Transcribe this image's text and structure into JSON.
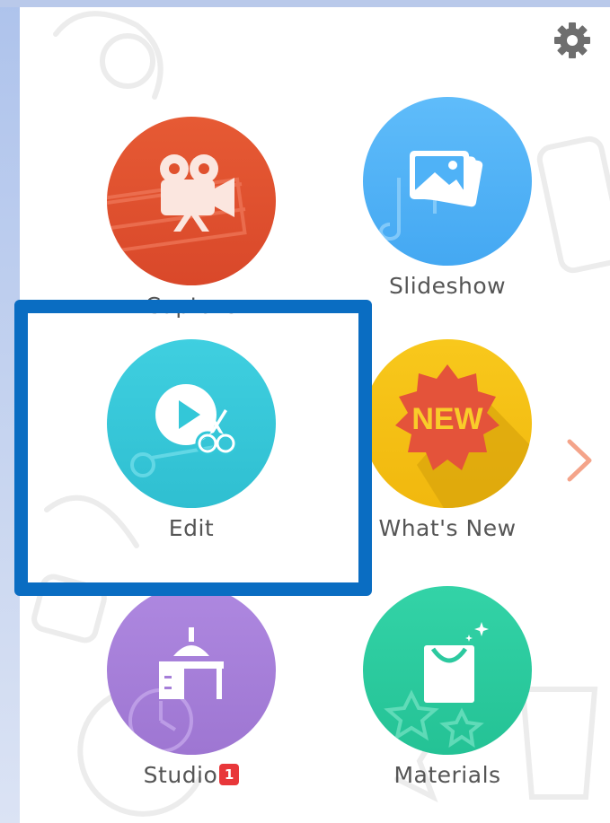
{
  "menu": {
    "items": [
      {
        "id": "capture",
        "label": "Capture",
        "icon": "video-camera-icon",
        "color": "#e0512e"
      },
      {
        "id": "slideshow",
        "label": "Slideshow",
        "icon": "photo-stack-icon",
        "color": "#4fb2f7"
      },
      {
        "id": "edit",
        "label": "Edit",
        "icon": "play-scissors-icon",
        "color": "#33c7d8"
      },
      {
        "id": "whats_new",
        "label": "What's New",
        "icon": "new-burst-icon",
        "color": "#f5c016"
      },
      {
        "id": "studio",
        "label": "Studio",
        "icon": "desk-lamp-icon",
        "color": "#a57ed8",
        "badge": "1"
      },
      {
        "id": "materials",
        "label": "Materials",
        "icon": "shopping-bag-icon",
        "color": "#2cc99f"
      }
    ]
  },
  "whats_new_burst_text": "NEW",
  "settings_icon": "gear-icon",
  "next_icon": "chevron-right-icon",
  "highlight_color": "#0a6dc2"
}
